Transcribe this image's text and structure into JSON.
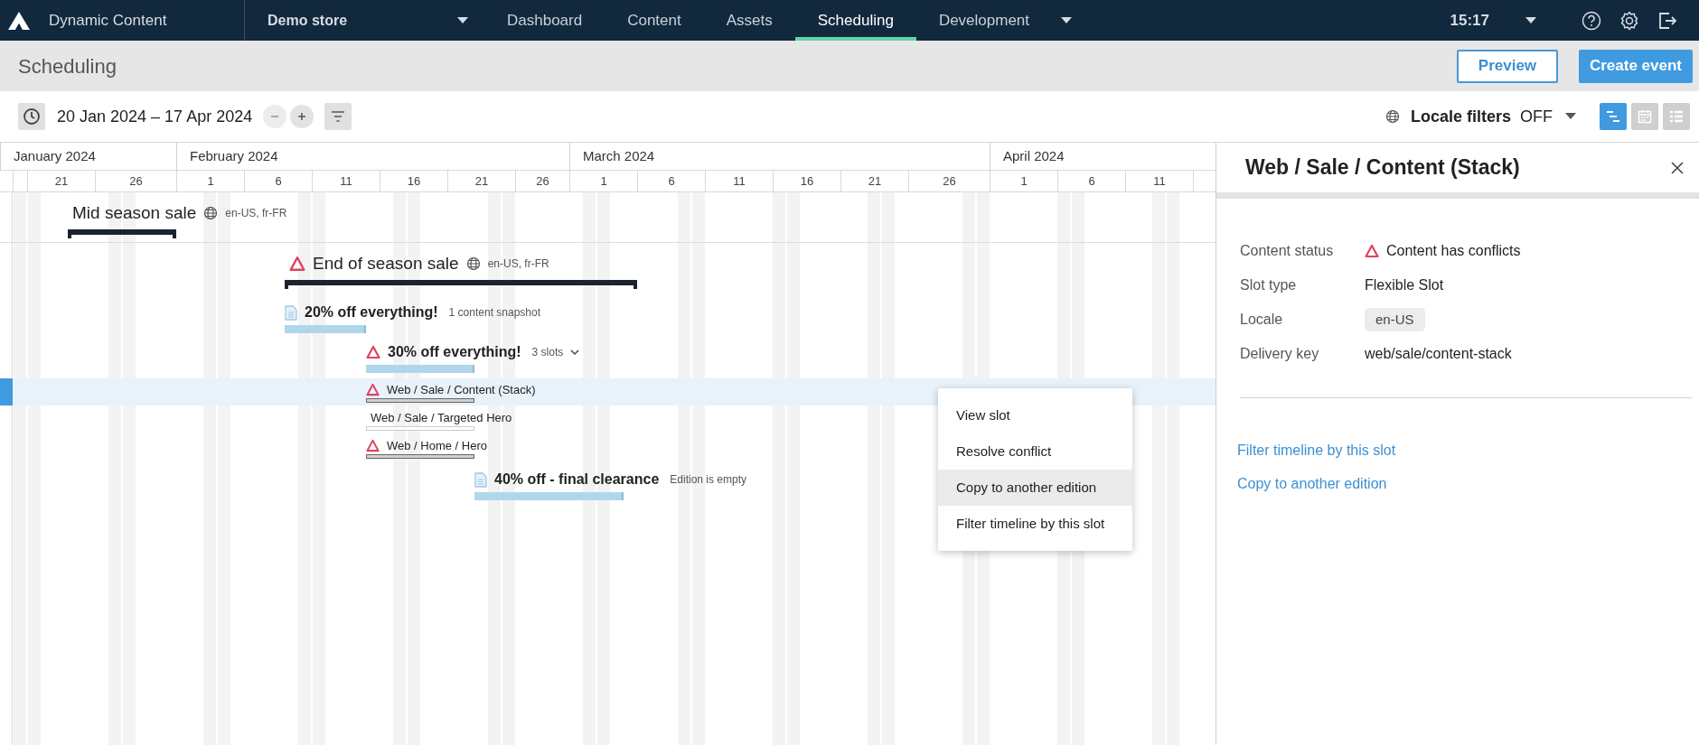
{
  "nav": {
    "product": "Dynamic Content",
    "store": "Demo store",
    "tabs": [
      {
        "label": "Dashboard",
        "selected": false
      },
      {
        "label": "Content",
        "selected": false
      },
      {
        "label": "Assets",
        "selected": false
      },
      {
        "label": "Scheduling",
        "selected": true
      },
      {
        "label": "Development",
        "selected": false
      }
    ],
    "time": "15:17"
  },
  "header": {
    "title": "Scheduling",
    "preview": "Preview",
    "create": "Create event"
  },
  "toolbar": {
    "date_range": "20 Jan 2024 – 17 Apr 2024",
    "locale_label": "Locale filters",
    "locale_value": "OFF",
    "views": [
      {
        "kind": "timeline",
        "selected": true
      },
      {
        "kind": "calendar",
        "selected": false
      },
      {
        "kind": "list",
        "selected": false
      }
    ]
  },
  "timeline": {
    "months": [
      "January 2024",
      "February 2024",
      "March 2024",
      "April 2024"
    ],
    "days": [
      "21",
      "26",
      "1",
      "6",
      "11",
      "16",
      "21",
      "26",
      "1",
      "6",
      "11",
      "16",
      "21",
      "26",
      "1",
      "6",
      "11"
    ],
    "events": [
      {
        "title": "Mid season sale",
        "locales": "en-US, fr-FR",
        "conflict": false
      },
      {
        "title": "End of season sale",
        "locales": "en-US, fr-FR",
        "conflict": true,
        "editions": [
          {
            "title": "20% off everything!",
            "note": "1 content snapshot",
            "conflict": false
          },
          {
            "title": "30% off everything!",
            "note": "3 slots",
            "conflict": true,
            "expanded": true,
            "slots": [
              {
                "name": "Web / Sale / Content (Stack)",
                "conflict": true,
                "selected": true
              },
              {
                "name": "Web / Sale / Targeted Hero",
                "conflict": false,
                "selected": false
              },
              {
                "name": "Web / Home / Hero",
                "conflict": true,
                "selected": false
              }
            ]
          },
          {
            "title": "40% off - final clearance",
            "note": "Edition is empty",
            "conflict": false
          }
        ]
      }
    ]
  },
  "context_menu": [
    {
      "label": "View slot",
      "hovered": false
    },
    {
      "label": "Resolve conflict",
      "hovered": false
    },
    {
      "label": "Copy to another edition",
      "hovered": true
    },
    {
      "label": "Filter timeline by this slot",
      "hovered": false
    }
  ],
  "panel": {
    "title": "Web / Sale / Content (Stack)",
    "fields": [
      {
        "label": "Content status",
        "value": "Content has conflicts",
        "kind": "status"
      },
      {
        "label": "Slot type",
        "value": "Flexible Slot",
        "kind": "text"
      },
      {
        "label": "Locale",
        "value": "en-US",
        "kind": "tag"
      },
      {
        "label": "Delivery key",
        "value": "web/sale/content-stack",
        "kind": "text"
      }
    ],
    "links": [
      "Filter timeline by this slot",
      "Copy to another edition"
    ]
  }
}
